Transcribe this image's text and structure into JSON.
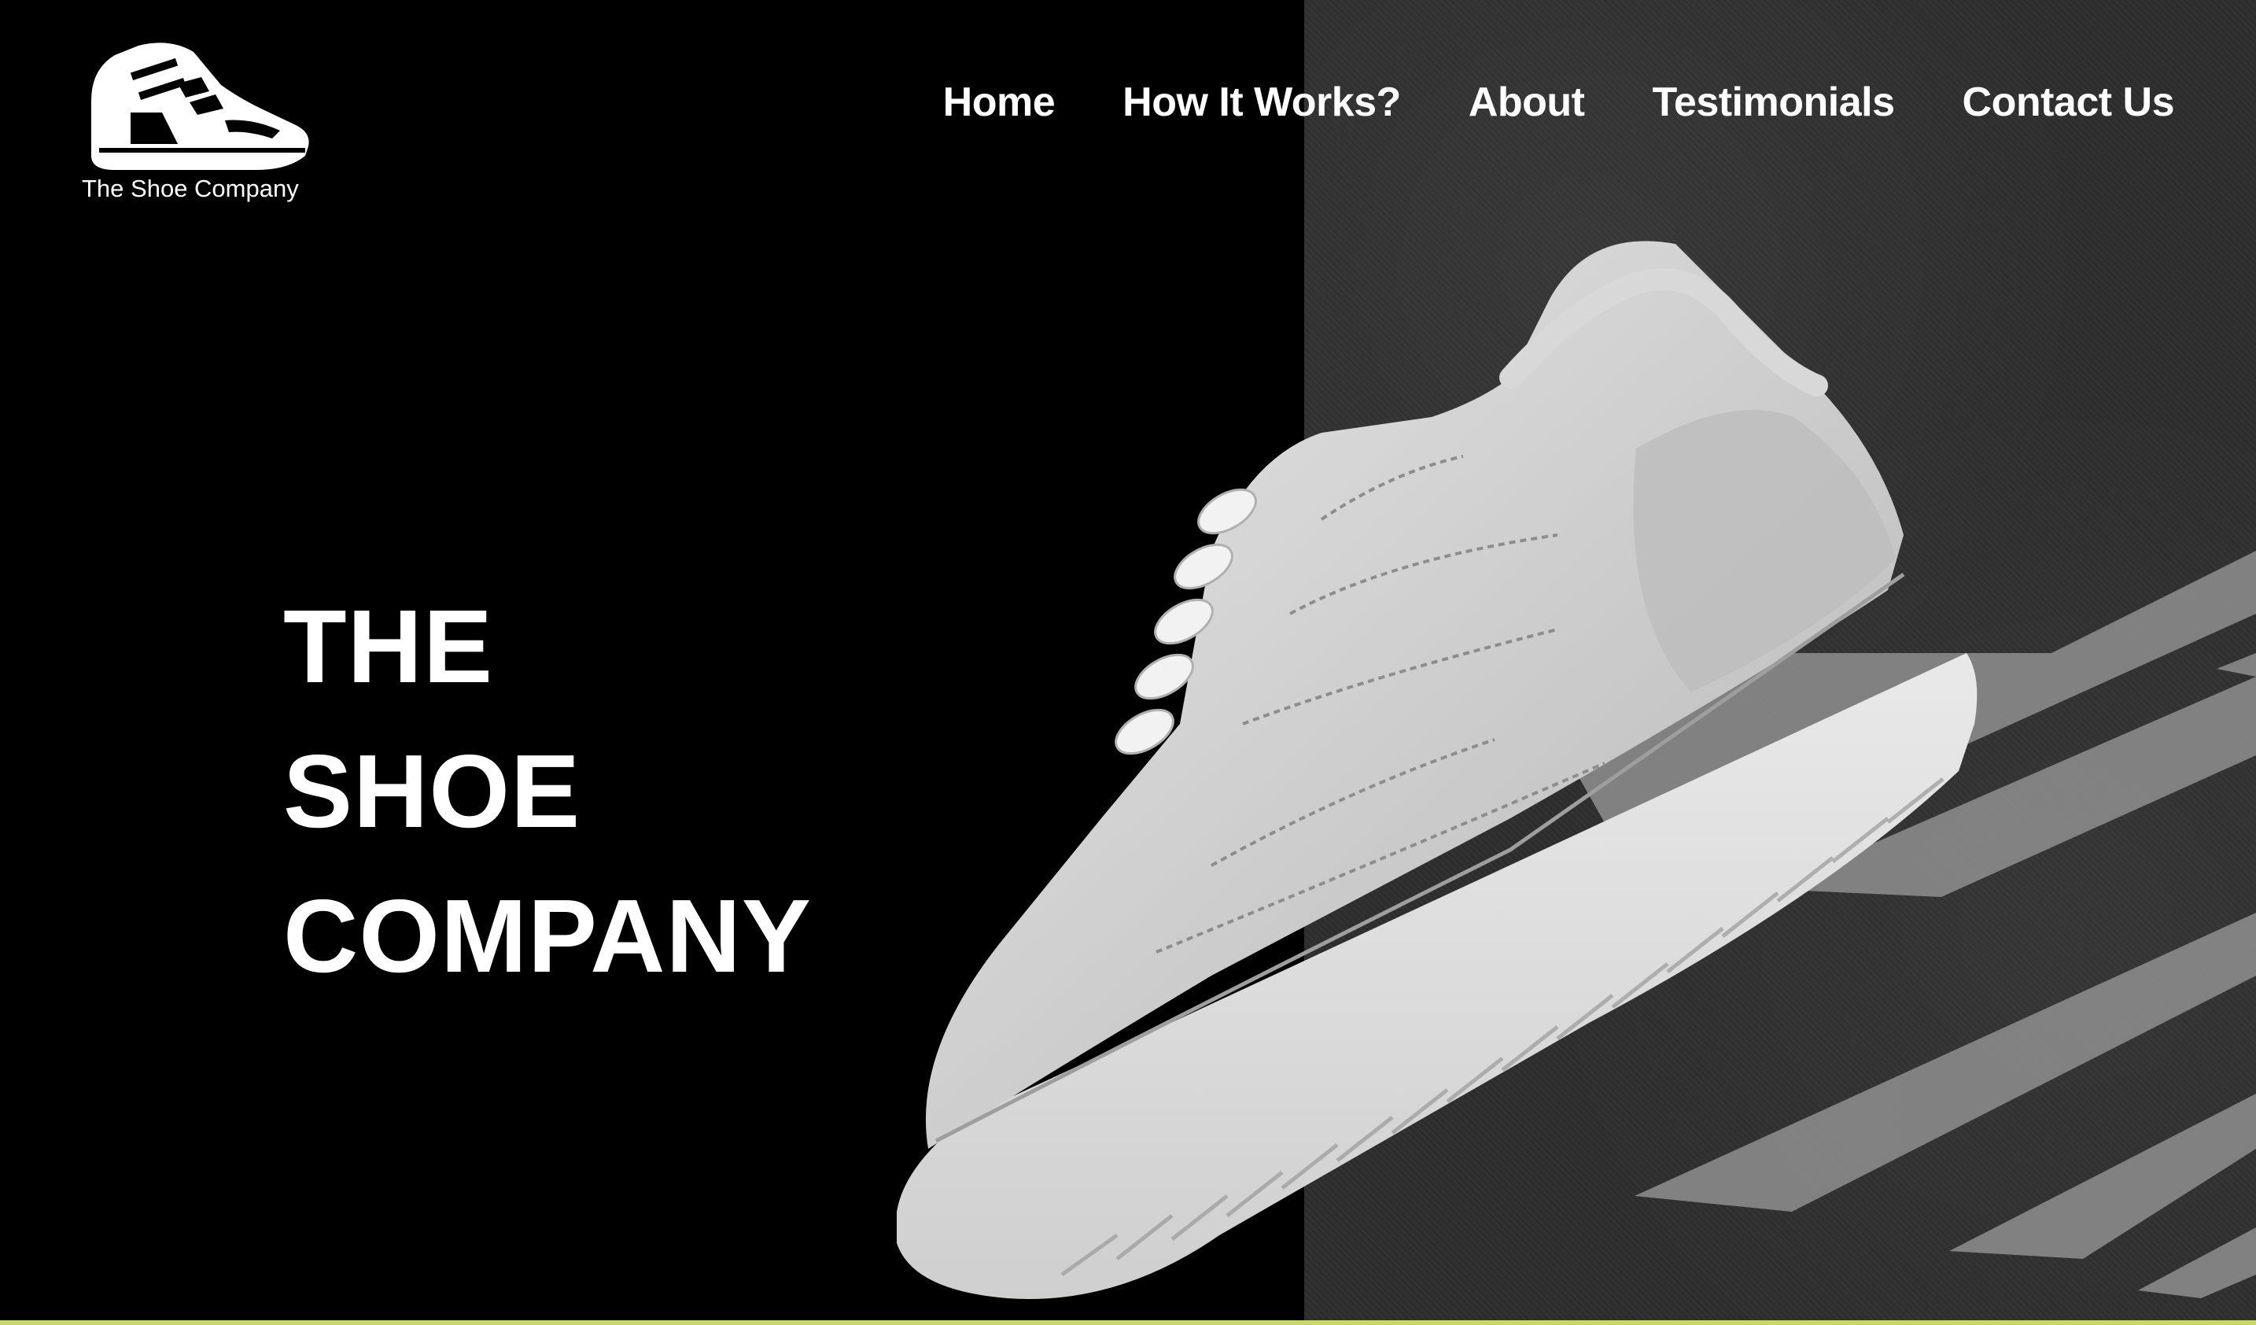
{
  "brand": {
    "name": "The Shoe Company",
    "logo_icon": "sneaker-logo-icon"
  },
  "nav": {
    "items": [
      {
        "label": "Home"
      },
      {
        "label": "How It Works?"
      },
      {
        "label": "About"
      },
      {
        "label": "Testimonials"
      },
      {
        "label": "Contact Us"
      }
    ]
  },
  "hero": {
    "title_lines": [
      "THE",
      "SHOE",
      "COMPANY"
    ],
    "image": "white-sneaker-image"
  },
  "colors": {
    "background": "#000000",
    "text": "#ffffff",
    "asphalt": "#2e2e2e",
    "road_stripe": "#8c8c8c",
    "accent_line": "#c8d66a"
  }
}
